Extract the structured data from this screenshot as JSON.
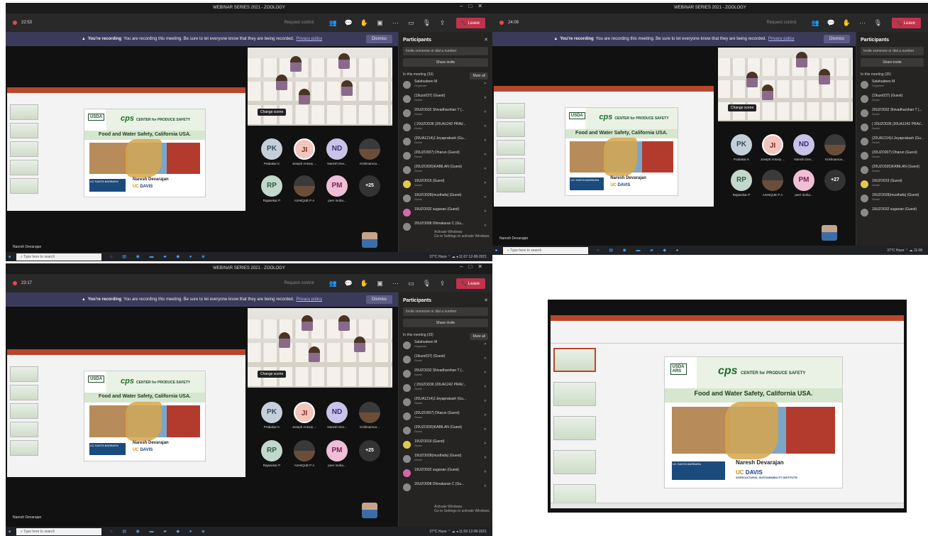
{
  "window_title": "WEBINAR SERIES 2021 - ZOOLOGY",
  "toolbar": {
    "request_control": "Request control",
    "leave": "Leave"
  },
  "banner": {
    "heading": "You're recording",
    "text": "You are recording this meeting. Be sure to let everyone know that they are being recorded.",
    "link": "Privacy policy",
    "dismiss": "Dismiss"
  },
  "timers": [
    "22:53",
    "24:09",
    "23:17"
  ],
  "video": {
    "change_scene": "Change scene"
  },
  "slide": {
    "usda": "USDA",
    "ars": "ARS",
    "cps": "cps",
    "cps_sub": "CENTER for PRODUCE SAFETY",
    "title": "Food and Water Safety, California USA.",
    "speaker": "Naresh Devarajan",
    "uc": "UC",
    "davis": "DAVIS",
    "institute": "AGRICULTURAL SUSTAINABILITY INSTITUTE",
    "ucsb": "UC SANTA BARBARA"
  },
  "participants_grid": [
    {
      "initials": "PK",
      "name": "Prabakar K"
    },
    {
      "initials": "JI",
      "name": "Joseph Antony ..."
    },
    {
      "initials": "ND",
      "name": "Naresh Dev..."
    },
    {
      "initials": "",
      "name": "Krishnamoo..."
    },
    {
      "initials": "RP",
      "name": "Rajasekar P"
    },
    {
      "initials": "",
      "name": "ASHIQUE P A"
    },
    {
      "initials": "PM",
      "name": "peer moha..."
    },
    {
      "initials": "+25",
      "name": ""
    }
  ],
  "more_count_2": "+27",
  "presenter_tag": "Naresh Devarajan",
  "panel": {
    "title": "Participants",
    "invite_placeholder": "Invite someone or dial a number",
    "share_invite": "Share invite",
    "in_meeting": "In this meeting (33)",
    "in_meeting_2": "In this meeting (35)",
    "mute_all": "Mute all",
    "people": [
      {
        "name": "Salahudeen M",
        "role": "Organizer"
      },
      {
        "name": "(19uzo037) (Guest)",
        "role": "Guest"
      },
      {
        "name": "20UZO032 Shivadharshan T (...",
        "role": "Guest"
      },
      {
        "name": "( 20UZO036 )20UA1242 PRAV...",
        "role": "Guest"
      },
      {
        "name": "(20UA1214)J.Jeyaprakash (Gu...",
        "role": "Guest"
      },
      {
        "name": "(20UZO007) Dharun (Guest)",
        "role": "Guest"
      },
      {
        "name": "(20UZO035)KABILAN (Guest)",
        "role": "Guest"
      },
      {
        "name": "19UZO019 (Guest)",
        "role": "Guest"
      },
      {
        "name": "19UZO028(musthafa) (Guest)",
        "role": "Guest"
      },
      {
        "name": "19UZO032 suganan (Guest)",
        "role": "Guest"
      },
      {
        "name": "20UZO008 Dhinakaran C (Gu...",
        "role": "Guest"
      }
    ]
  },
  "activate": {
    "line1": "Activate Windows",
    "line2": "Go to Settings to activate Windows."
  },
  "taskbar": {
    "search": "Type here to search",
    "weather": "37°C Haze",
    "time": "11:07",
    "date": "12-08-2021",
    "time2": "11:08",
    "time3": "11:09"
  }
}
